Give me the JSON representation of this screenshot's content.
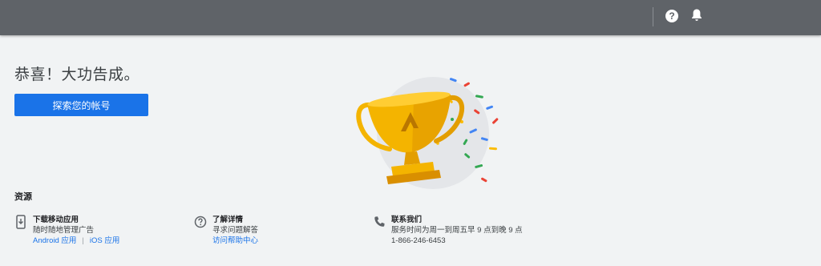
{
  "topbar": {
    "help_icon": "help-circle-icon",
    "notification_icon": "bell-icon",
    "help_glyph": "?"
  },
  "main": {
    "title": "恭喜！大功告成。",
    "explore_button": "探索您的帐号",
    "illustration": "trophy-illustration"
  },
  "resources": {
    "heading": "资源",
    "items": [
      {
        "icon": "mobile-download-icon",
        "title": "下载移动应用",
        "description": "随时随地管理广告",
        "links": [
          "Android 应用",
          "iOS 应用"
        ],
        "separator": "|"
      },
      {
        "icon": "help-circle-icon",
        "title": "了解详情",
        "description": "寻求问题解答",
        "link": "访问帮助中心"
      },
      {
        "icon": "phone-icon",
        "title": "联系我们",
        "description": "服务时间为周一到周五早 9 点到晚 9 点",
        "phone": "1-866-246-6453"
      }
    ]
  },
  "colors": {
    "topbar": "#5f6368",
    "background": "#f1f3f4",
    "primary": "#1a73e8",
    "trophy": "#f4b400"
  }
}
